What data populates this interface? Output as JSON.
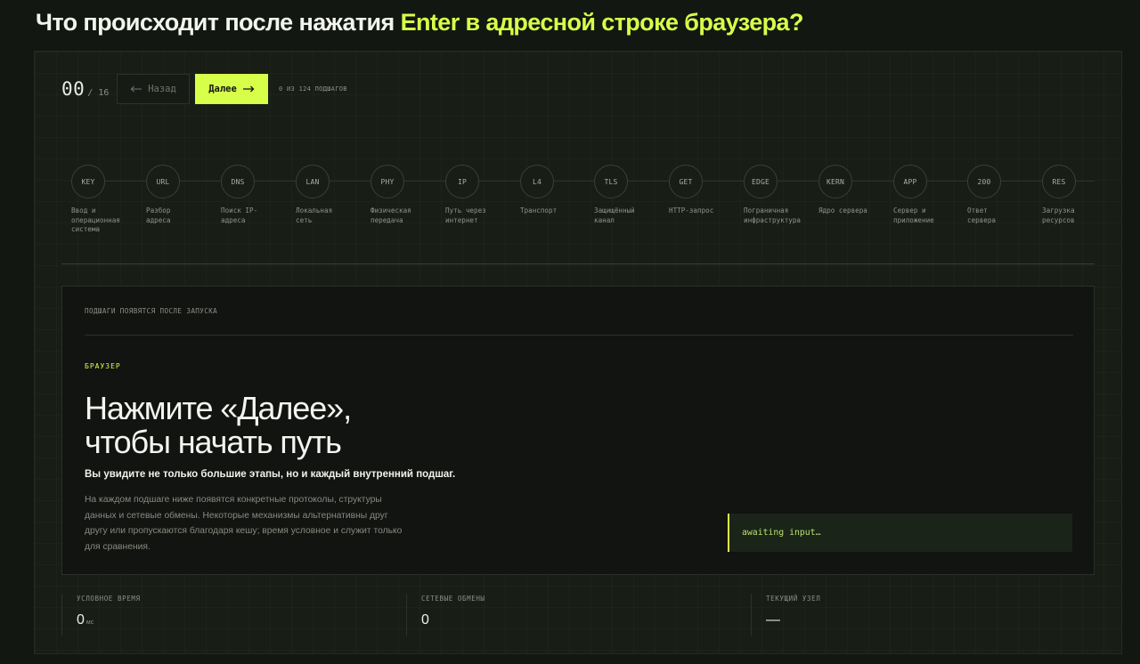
{
  "header": {
    "title_plain": "Что происходит после нажатия",
    "title_accent": "Enter в адресной строке браузера?"
  },
  "toolbar": {
    "step_current": "00",
    "step_total": "/ 16",
    "back_icon": "arrow-left-icon",
    "back_label": "Назад",
    "next_label": "Далее",
    "next_icon": "arrow-right-icon",
    "substep_counter": "0 ИЗ 124 ПОДШАГОВ"
  },
  "stages": [
    {
      "code": "KEY",
      "label": "Ввод и\nоперационная\nсистема"
    },
    {
      "code": "URL",
      "label": "Разбор\nадреса"
    },
    {
      "code": "DNS",
      "label": "Поиск IP-\nадреса"
    },
    {
      "code": "LAN",
      "label": "Локальная\nсеть"
    },
    {
      "code": "PHY",
      "label": "Физическая\nпередача"
    },
    {
      "code": "IP",
      "label": "Путь через\nинтернет"
    },
    {
      "code": "L4",
      "label": "Транспорт"
    },
    {
      "code": "TLS",
      "label": "Защищённый\nканал"
    },
    {
      "code": "GET",
      "label": "HTTP-запрос"
    },
    {
      "code": "EDGE",
      "label": "Пограничная\nинфраструктура"
    },
    {
      "code": "KERN",
      "label": "Ядро сервера"
    },
    {
      "code": "APP",
      "label": "Сервер и\nприложение"
    },
    {
      "code": "200",
      "label": "Ответ\nсервера"
    },
    {
      "code": "RES",
      "label": "Загрузка\nресурсов"
    }
  ],
  "card": {
    "substeps_note": "ПОДШАГИ ПОЯВЯТСЯ ПОСЛЕ ЗАПУСКА",
    "section_tag": "БРАУЗЕР",
    "headline": "Нажмите «Далее»,\nчтобы начать путь",
    "subheadline": "Вы увидите не только большие этапы, но и каждый внутренний подшаг.",
    "description": "На каждом подшаге ниже появятся конкретные протоколы, структуры данных и сетевые обмены. Некоторые механизмы альтернативны друг другу или пропускаются благодаря кешу; время условное и служит только для сравнения.",
    "console_text": "awaiting input…"
  },
  "metrics": {
    "time_label": "УСЛОВНОЕ ВРЕМЯ",
    "time_value": "0",
    "time_unit": "мс",
    "exchanges_label": "СЕТЕВЫЕ ОБМЕНЫ",
    "exchanges_value": "0",
    "node_label": "ТЕКУЩИЙ УЗЕЛ",
    "node_value": "—"
  },
  "colors": {
    "accent": "#d7ff4a",
    "background": "#131712",
    "panel": "#181d16",
    "console_text": "#b6e071"
  }
}
